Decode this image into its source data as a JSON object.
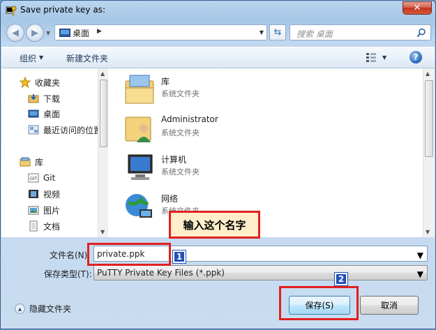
{
  "window": {
    "title": "Save private key as:"
  },
  "nav": {
    "address": "桌面",
    "search_placeholder": "搜索 桌面"
  },
  "toolbar": {
    "organize": "组织",
    "new_folder": "新建文件夹"
  },
  "sidebar": {
    "items": [
      {
        "label": "收藏夹",
        "icon": "star-icon"
      },
      {
        "label": "下载",
        "icon": "download-folder-icon"
      },
      {
        "label": "桌面",
        "icon": "desktop-icon"
      },
      {
        "label": "最近访问的位置",
        "icon": "recent-places-icon"
      },
      {
        "label": "库",
        "icon": "library-icon"
      },
      {
        "label": "Git",
        "icon": "git-folder-icon"
      },
      {
        "label": "视频",
        "icon": "video-icon"
      },
      {
        "label": "图片",
        "icon": "picture-icon"
      },
      {
        "label": "文档",
        "icon": "document-icon"
      }
    ]
  },
  "files": [
    {
      "name": "库",
      "type": "系统文件夹",
      "icon": "library-folder-icon"
    },
    {
      "name": "Administrator",
      "type": "系统文件夹",
      "icon": "user-folder-icon"
    },
    {
      "name": "计算机",
      "type": "系统文件夹",
      "icon": "computer-icon"
    },
    {
      "name": "网络",
      "type": "系统文件夹",
      "icon": "network-icon"
    }
  ],
  "form": {
    "filename_label": "文件名(N):",
    "filename_value": "private.ppk",
    "filetype_label": "保存类型(T):",
    "filetype_value": "PuTTY Private Key Files (*.ppk)",
    "hide_folders": "隐藏文件夹",
    "save": "保存(S)",
    "cancel": "取消"
  },
  "annotations": {
    "callout": "输入这个名字",
    "badge1": "1",
    "badge2": "2"
  },
  "colors": {
    "highlight": "#e02020",
    "badge": "#2050b8"
  }
}
